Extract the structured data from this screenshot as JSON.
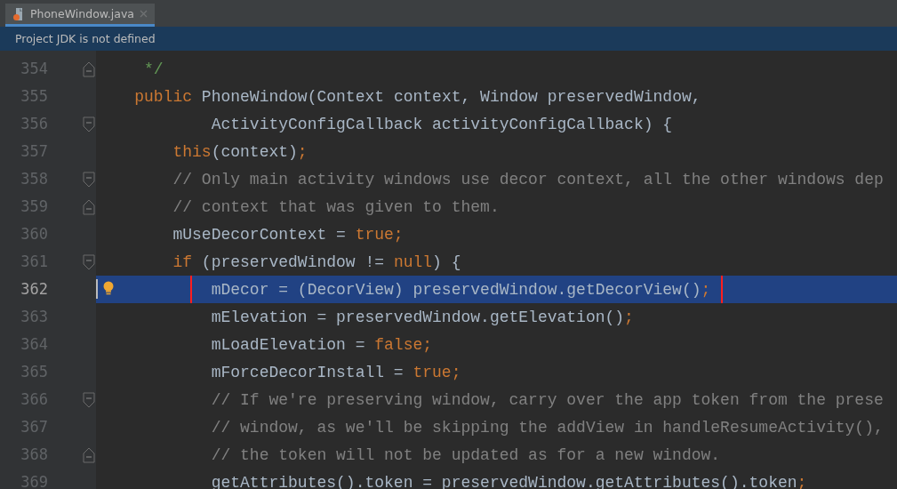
{
  "tabs": [
    {
      "label": "PhoneWindow.java",
      "selected": true
    }
  ],
  "banner": {
    "text": "Project JDK is not defined"
  },
  "lines": [
    {
      "number": "354",
      "fold_end": true,
      "tokens": [
        {
          "kind": "doc",
          "text": "     */"
        }
      ]
    },
    {
      "number": "355",
      "tokens": [
        {
          "kind": "kw",
          "text": "    public "
        },
        {
          "kind": "plain",
          "text": "PhoneWindow(Context context, Window preservedWindow,"
        }
      ]
    },
    {
      "number": "356",
      "fold_start": true,
      "tokens": [
        {
          "kind": "plain",
          "text": "            ActivityConfigCallback activityConfigCallback) {"
        }
      ]
    },
    {
      "number": "357",
      "tokens": [
        {
          "kind": "kw",
          "text": "        this"
        },
        {
          "kind": "plain",
          "text": "(context)"
        },
        {
          "kind": "kw",
          "text": ";"
        }
      ]
    },
    {
      "number": "358",
      "fold_start": true,
      "tokens": [
        {
          "kind": "comment",
          "text": "        // Only main activity windows use decor context, all the other windows dep"
        }
      ]
    },
    {
      "number": "359",
      "fold_end": true,
      "tokens": [
        {
          "kind": "comment",
          "text": "        // context that was given to them."
        }
      ]
    },
    {
      "number": "360",
      "tokens": [
        {
          "kind": "plain",
          "text": "        mUseDecorContext = "
        },
        {
          "kind": "kw",
          "text": "true;"
        }
      ]
    },
    {
      "number": "361",
      "fold_start": true,
      "tokens": [
        {
          "kind": "kw",
          "text": "        if "
        },
        {
          "kind": "plain",
          "text": "(preservedWindow != "
        },
        {
          "kind": "kw",
          "text": "null"
        },
        {
          "kind": "plain",
          "text": ") {"
        }
      ]
    },
    {
      "number": "362",
      "selected": true,
      "boxed": true,
      "bulb": true,
      "tokens": [
        {
          "kind": "plain",
          "text": "            mDecor = (DecorView) preservedWindow.getDecorView()"
        },
        {
          "kind": "kw",
          "text": ";"
        }
      ]
    },
    {
      "number": "363",
      "tokens": [
        {
          "kind": "plain",
          "text": "            mElevation = preservedWindow.getElevation()"
        },
        {
          "kind": "kw",
          "text": ";"
        }
      ]
    },
    {
      "number": "364",
      "tokens": [
        {
          "kind": "plain",
          "text": "            mLoadElevation = "
        },
        {
          "kind": "kw",
          "text": "false;"
        }
      ]
    },
    {
      "number": "365",
      "tokens": [
        {
          "kind": "plain",
          "text": "            mForceDecorInstall = "
        },
        {
          "kind": "kw",
          "text": "true;"
        }
      ]
    },
    {
      "number": "366",
      "fold_start": true,
      "tokens": [
        {
          "kind": "comment",
          "text": "            // If we're preserving window, carry over the app token from the prese"
        }
      ]
    },
    {
      "number": "367",
      "tokens": [
        {
          "kind": "comment",
          "text": "            // window, as we'll be skipping the addView in handleResumeActivity(),"
        }
      ]
    },
    {
      "number": "368",
      "fold_end": true,
      "tokens": [
        {
          "kind": "comment",
          "text": "            // the token will not be updated as for a new window."
        }
      ]
    },
    {
      "number": "369",
      "tokens": [
        {
          "kind": "plain",
          "text": "            getAttributes().token = preservedWindow.getAttributes().token"
        },
        {
          "kind": "kw",
          "text": ";"
        }
      ]
    }
  ]
}
